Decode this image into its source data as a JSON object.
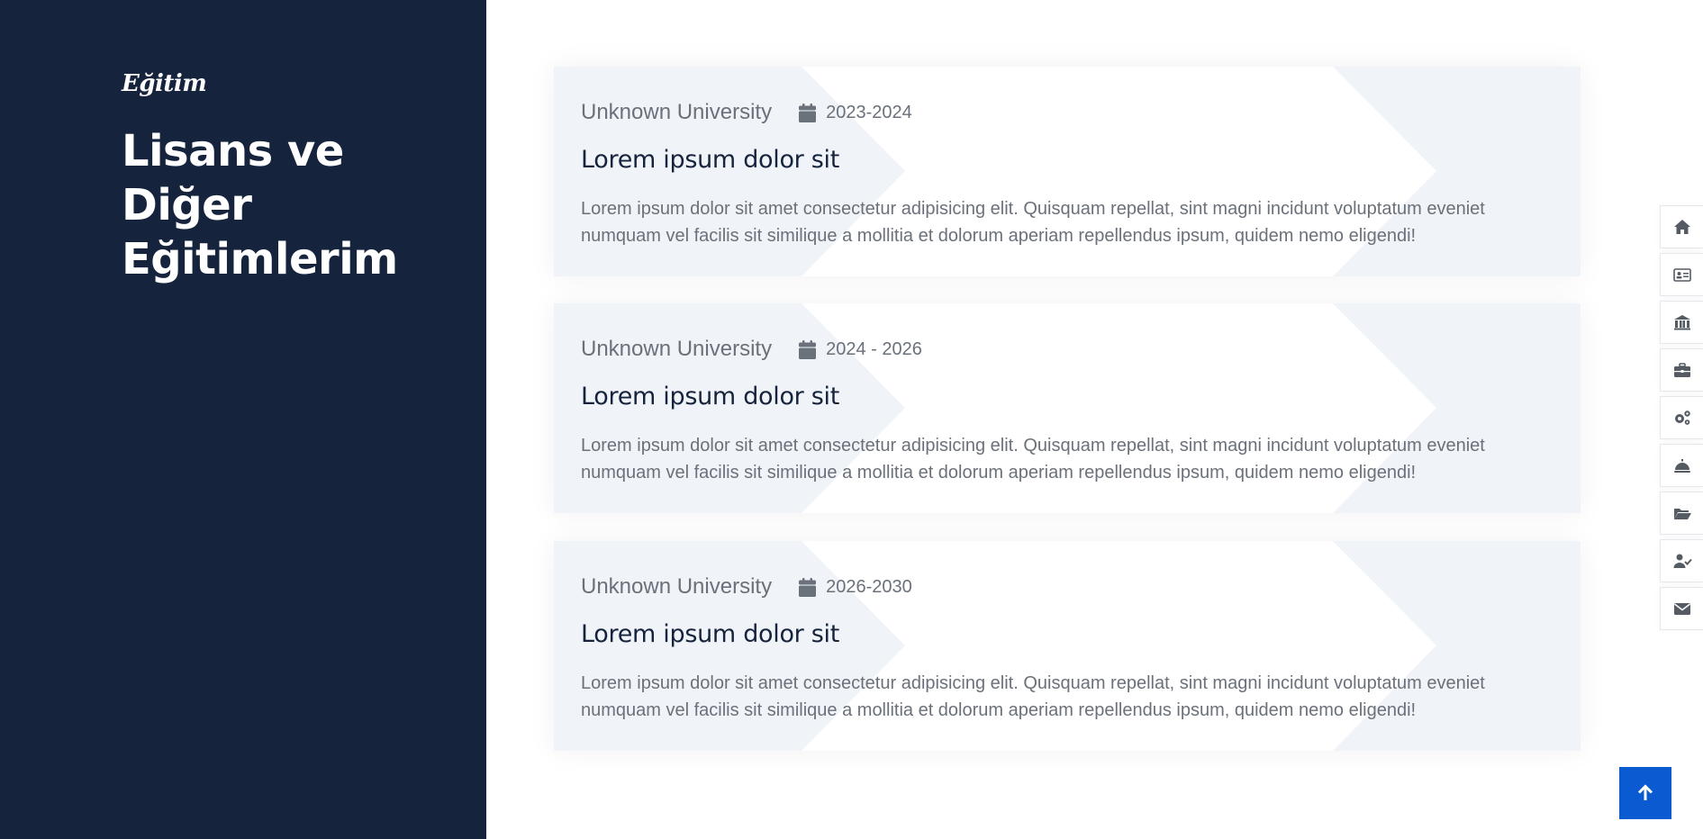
{
  "sidebar": {
    "section_label": "Eğitim",
    "section_title": "Lisans ve Diğer Eğitimlerim"
  },
  "education": [
    {
      "university": "Unknown University",
      "date": "2023-2024",
      "title": "Lorem ipsum dolor sit",
      "description": "Lorem ipsum dolor sit amet consectetur adipisicing elit. Quisquam repellat, sint magni incidunt voluptatum eveniet numquam vel facilis sit similique a mollitia et dolorum aperiam repellendus ipsum, quidem nemo eligendi!"
    },
    {
      "university": "Unknown University",
      "date": "2024 - 2026",
      "title": "Lorem ipsum dolor sit",
      "description": "Lorem ipsum dolor sit amet consectetur adipisicing elit. Quisquam repellat, sint magni incidunt voluptatum eveniet numquam vel facilis sit similique a mollitia et dolorum aperiam repellendus ipsum, quidem nemo eligendi!"
    },
    {
      "university": "Unknown University",
      "date": "2026-2030",
      "title": "Lorem ipsum dolor sit",
      "description": "Lorem ipsum dolor sit amet consectetur adipisicing elit. Quisquam repellat, sint magni incidunt voluptatum eveniet numquam vel facilis sit similique a mollitia et dolorum aperiam repellendus ipsum, quidem nemo eligendi!"
    }
  ],
  "side_nav": {
    "icons": [
      "home-icon",
      "id-card-icon",
      "university-icon",
      "briefcase-icon",
      "gears-icon",
      "service-bell-icon",
      "folder-open-icon",
      "user-check-icon",
      "envelope-icon"
    ]
  },
  "back_to_top": {
    "icon": "arrow-up-icon"
  },
  "colors": {
    "sidebar_bg": "#16233d",
    "card_bg": "#f0f3f8",
    "accent": "#0a5bd2",
    "muted_text": "#6b717a",
    "heading_text": "#16233d"
  }
}
